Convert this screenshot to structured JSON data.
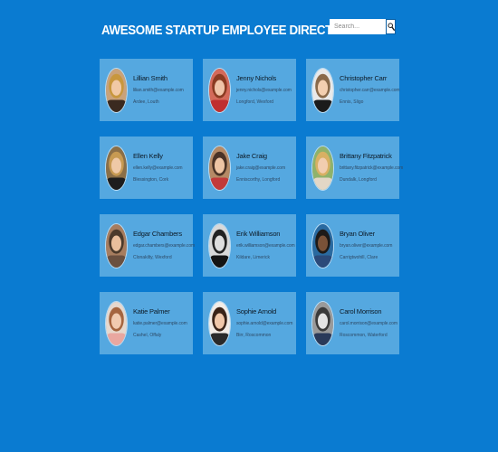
{
  "header": {
    "title": "AWESOME STARTUP EMPLOYEE DIRECTORY",
    "search_placeholder": "Search...",
    "search_icon": "magnifier-icon"
  },
  "colors": {
    "background": "#0a7bd1",
    "card": "#55a8e0"
  },
  "employees": [
    {
      "name": "Lillian Smith",
      "email": "lilian.smith@example.com",
      "location": "Ardee, Louth",
      "bg": "#c9a27a",
      "hair": "#c8973d",
      "skin": "#f1c9a5",
      "shirt": "#3a2a20"
    },
    {
      "name": "Jenny Nichols",
      "email": "jenny.nichols@example.com",
      "location": "Longford, Wexford",
      "bg": "#d46a5a",
      "hair": "#8a3b22",
      "skin": "#f0c4a8",
      "shirt": "#c03030"
    },
    {
      "name": "Christopher Carr",
      "email": "christopher.carr@example.com",
      "location": "Ennis, Sligo",
      "bg": "#e9e9e9",
      "hair": "#8a6a4a",
      "skin": "#f3cfb0",
      "shirt": "#1b1b1b"
    },
    {
      "name": "Ellen Kelly",
      "email": "ellen.kelly@example.com",
      "location": "Blessington, Cork",
      "bg": "#8b6f47",
      "hair": "#c79a52",
      "skin": "#efc9a6",
      "shirt": "#1d1d1d"
    },
    {
      "name": "Jake Craig",
      "email": "jake.craig@example.com",
      "location": "Enniscorthy, Longford",
      "bg": "#b58a66",
      "hair": "#4a3326",
      "skin": "#eec5a4",
      "shirt": "#c23a3a"
    },
    {
      "name": "Brittany Fitzpatrick",
      "email": "brittany.fitzpatrick@example.com",
      "location": "Dundalk, Longford",
      "bg": "#8fb26b",
      "hair": "#d8b063",
      "skin": "#f2cdaf",
      "shirt": "#e3d7c6"
    },
    {
      "name": "Edgar Chambers",
      "email": "edgar.chambers@example.com",
      "location": "Clonakilty, Wexford",
      "bg": "#a77d5f",
      "hair": "#4b3a2b",
      "skin": "#e9bf9c",
      "shirt": "#6a5040"
    },
    {
      "name": "Erik Williamson",
      "email": "erik.williamson@example.com",
      "location": "Kildare, Limerick",
      "bg": "#d9d9d9",
      "hair": "#222222",
      "skin": "#dedede",
      "shirt": "#141414"
    },
    {
      "name": "Bryan Oliver",
      "email": "bryan.oliver@example.com",
      "location": "Carrigtwohill, Clare",
      "bg": "#2a6aa0",
      "hair": "#1d1a18",
      "skin": "#7a5238",
      "shirt": "#2b4a7a"
    },
    {
      "name": "Katie Palmer",
      "email": "katie.palmer@example.com",
      "location": "Cashel, Offaly",
      "bg": "#e7d8cd",
      "hair": "#a5653f",
      "skin": "#f1cbb0",
      "shirt": "#e9a7a0"
    },
    {
      "name": "Sophie Arnold",
      "email": "sophie.arnold@example.com",
      "location": "Birr, Roscommon",
      "bg": "#f2ece6",
      "hair": "#3a2418",
      "skin": "#f0c8aa",
      "shirt": "#2a2a2a"
    },
    {
      "name": "Carol Morrison",
      "email": "carol.morrison@example.com",
      "location": "Roscommon, Waterford",
      "bg": "#9a9a9a",
      "hair": "#3a3a3a",
      "skin": "#e4e4e4",
      "shirt": "#2a3a5a"
    }
  ]
}
